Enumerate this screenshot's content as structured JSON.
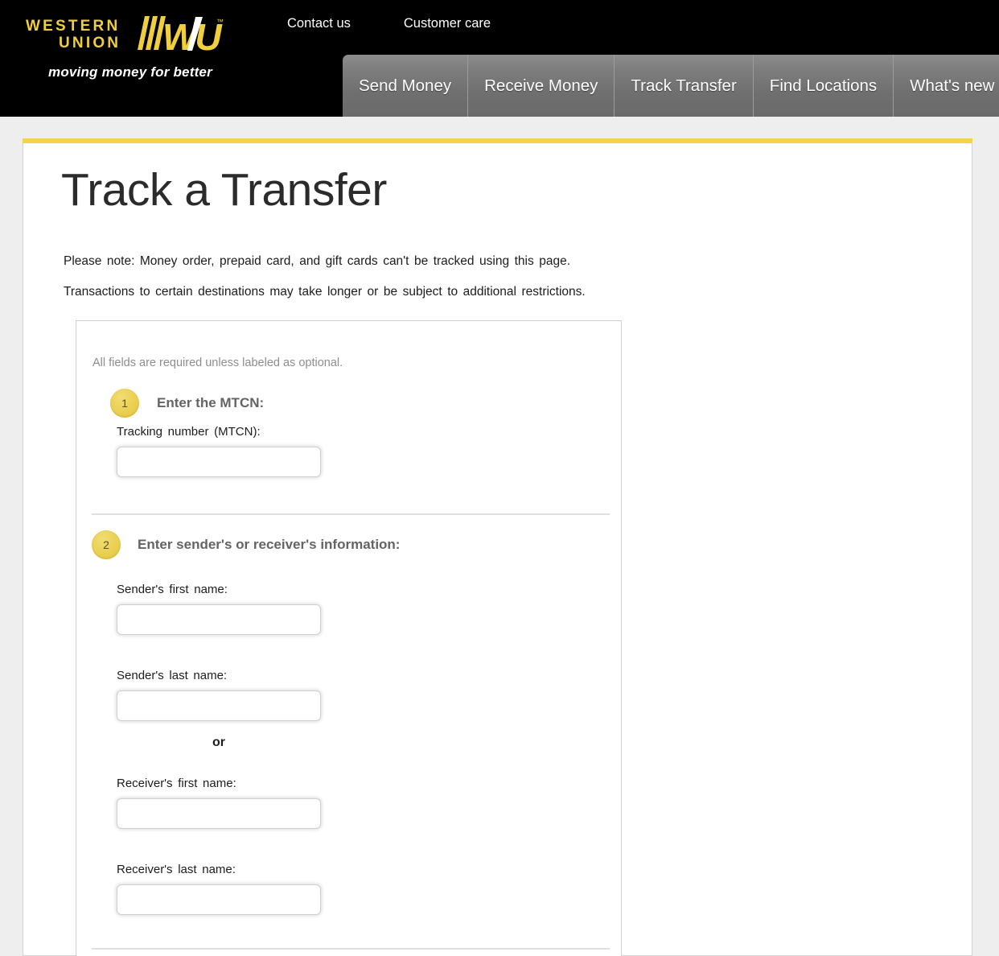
{
  "header": {
    "logo": {
      "line1": "WESTERN",
      "line2": "UNION",
      "mark": "WU",
      "trademark": "™",
      "tagline": "moving money for better"
    },
    "util_links": [
      {
        "label": "Contact us"
      },
      {
        "label": "Customer care"
      }
    ],
    "nav_tabs": [
      {
        "label": "Send Money"
      },
      {
        "label": "Receive Money"
      },
      {
        "label": "Track Transfer"
      },
      {
        "label": "Find Locations"
      },
      {
        "label": "What's new"
      }
    ]
  },
  "page": {
    "title": "Track a Transfer",
    "note_1": "Please note: Money order, prepaid card, and gift cards can't be tracked using this page.",
    "note_2": "Transactions to certain destinations may take longer or be subject to additional restrictions."
  },
  "form": {
    "required_note": "All fields are required unless labeled as optional.",
    "steps": [
      {
        "number": "1",
        "label": "Enter the MTCN:"
      },
      {
        "number": "2",
        "label": "Enter sender's or receiver's information:"
      }
    ],
    "fields": {
      "mtcn": {
        "label": "Tracking number (MTCN):",
        "value": "",
        "placeholder": ""
      },
      "sender_first": {
        "label": "Sender's first name:",
        "value": "",
        "placeholder": ""
      },
      "sender_last": {
        "label": "Sender's last name:",
        "value": "",
        "placeholder": ""
      },
      "receiver_first": {
        "label": "Receiver's first name:",
        "value": "",
        "placeholder": ""
      },
      "receiver_last": {
        "label": "Receiver's last name:",
        "value": "",
        "placeholder": ""
      }
    },
    "or_separator": "or"
  },
  "colors": {
    "brand_yellow": "#f2d44b",
    "header_black": "#000000",
    "page_bg": "#eeeeee",
    "nav_gray": "#7e7e7e",
    "step_badge": "#ecd258"
  }
}
